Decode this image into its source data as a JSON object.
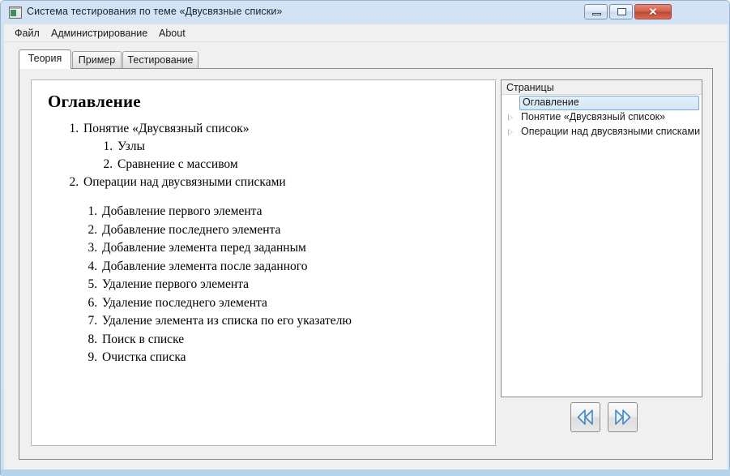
{
  "window": {
    "title": "Система тестирования по теме «Двусвязные списки»",
    "icon": "app-window-icon",
    "controls": {
      "minimize": "minimize-icon",
      "maximize": "maximize-icon",
      "close": "✕"
    },
    "accent_titlebar": "#cfe0f1",
    "accent_close": "#bc4630"
  },
  "menubar": {
    "items": [
      {
        "label": "Файл"
      },
      {
        "label": "Администрирование"
      },
      {
        "label": "About"
      }
    ]
  },
  "tabs": [
    {
      "label": "Теория",
      "active": true
    },
    {
      "label": "Пример",
      "active": false
    },
    {
      "label": "Тестирование",
      "active": false
    }
  ],
  "content": {
    "title": "Оглавление",
    "outline": [
      {
        "label": "Понятие «Двусвязный список»"
      },
      {
        "label": "Узлы"
      },
      {
        "label": "Сравнение с массивом"
      },
      {
        "label": "Операции над двусвязными списками"
      }
    ],
    "operations": [
      {
        "label": "Добавление первого элемента"
      },
      {
        "label": "Добавление последнего элемента"
      },
      {
        "label": "Добавление элемента перед заданным"
      },
      {
        "label": "Добавление элемента после заданного"
      },
      {
        "label": "Удаление первого элемента"
      },
      {
        "label": "Удаление последнего элемента"
      },
      {
        "label": "Удаление элемента из списка по его указателю"
      },
      {
        "label": "Поиск в списке"
      },
      {
        "label": "Очистка списка"
      }
    ]
  },
  "tree": {
    "header": "Страницы",
    "selection_fill": "#d4e7f8",
    "selection_border": "#7ea9d4",
    "items": [
      {
        "label": "Оглавление",
        "selected": true,
        "expandable": false
      },
      {
        "label": "Понятие «Двусвязный список»",
        "selected": false,
        "expandable": true
      },
      {
        "label": "Операции над двусвязными списками",
        "selected": false,
        "expandable": true
      }
    ]
  },
  "navigation": {
    "prev": {
      "name": "previous-page-button",
      "icon": "double-chevron-left-icon"
    },
    "next": {
      "name": "next-page-button",
      "icon": "double-chevron-right-icon"
    },
    "icon_color": "#4a85c0"
  }
}
